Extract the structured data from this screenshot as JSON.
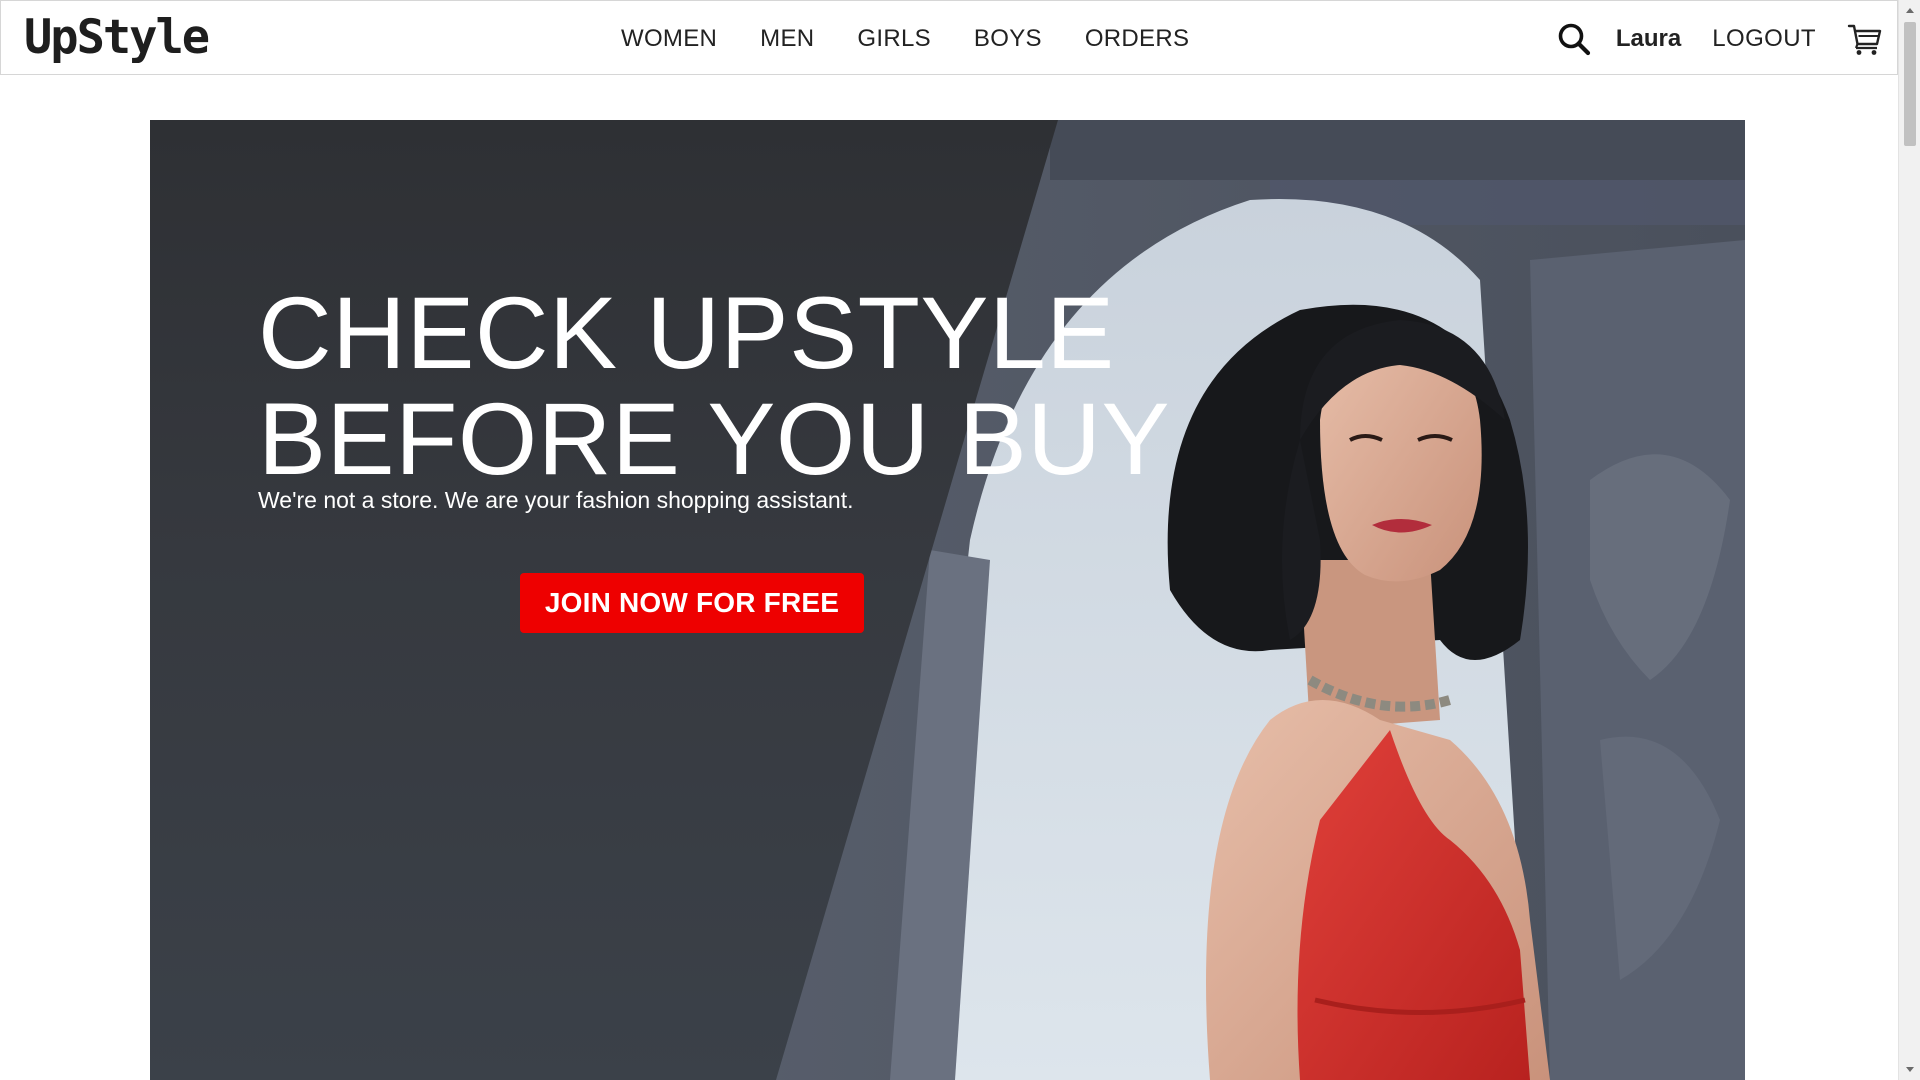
{
  "header": {
    "logo": "UpStyle",
    "nav": [
      "WOMEN",
      "MEN",
      "GIRLS",
      "BOYS",
      "ORDERS"
    ],
    "user_name": "Laura",
    "logout_label": "LOGOUT",
    "icons": {
      "search": "search-icon",
      "cart": "cart-icon"
    }
  },
  "hero": {
    "title_line1": "CHECK UPSTYLE",
    "title_line2": "BEFORE YOU BUY",
    "subtitle": "We're not a store. We are your fashion shopping assistant.",
    "cta_label": "JOIN NOW FOR FREE"
  },
  "colors": {
    "cta": "#ee0000",
    "dress": "#d8322e",
    "overlay": "#33363b"
  }
}
